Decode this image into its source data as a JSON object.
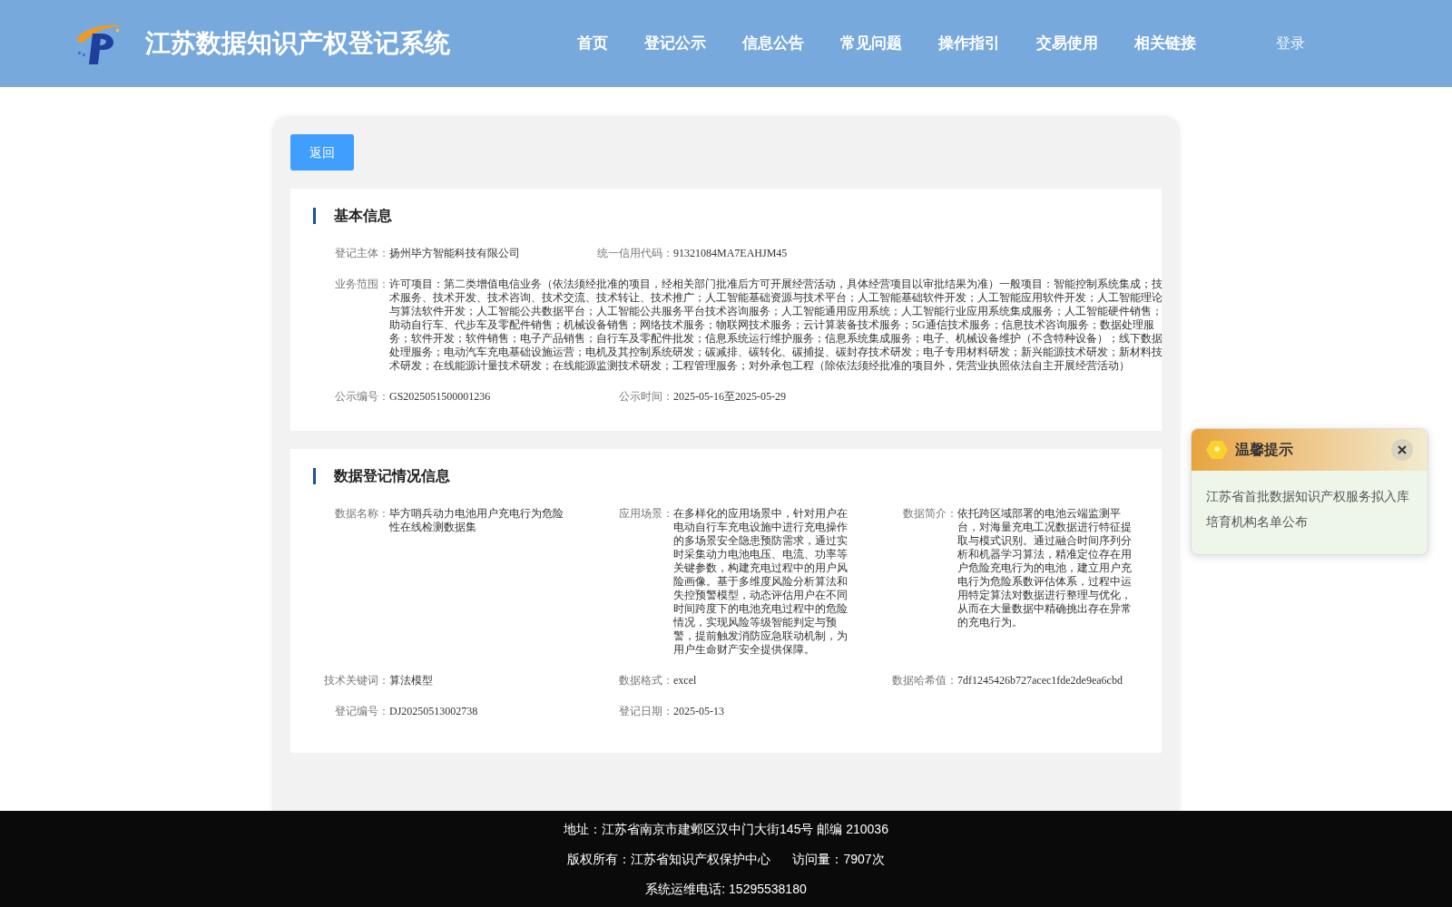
{
  "header": {
    "title": "江苏数据知识产权登记系统",
    "nav": [
      {
        "label": "首页",
        "selected": false
      },
      {
        "label": "登记公示",
        "selected": false
      },
      {
        "label": "信息公告",
        "selected": false
      },
      {
        "label": "常见问题",
        "selected": false
      },
      {
        "label": "操作指引",
        "selected": false
      },
      {
        "label": "交易使用",
        "selected": false
      },
      {
        "label": "相关链接",
        "selected": false
      }
    ],
    "login": "登录"
  },
  "back_button": "返回",
  "sections": [
    {
      "title": "基本信息",
      "rows": [
        [
          {
            "label": "登记主体：",
            "value": "扬州毕方智能科技有限公司"
          },
          {
            "label": "统一信用代码：",
            "value": "91321084MA7EAHJM45"
          }
        ],
        [
          {
            "label": "业务范围：",
            "value": "许可项目：第二类增值电信业务（依法须经批准的项目，经相关部门批准后方可开展经营活动，具体经营项目以审批结果为准）一般项目：智能控制系统集成；技术服务、技术开发、技术咨询、技术交流、技术转让、技术推广；人工智能基础资源与技术平台；人工智能基础软件开发；人工智能应用软件开发；人工智能理论与算法软件开发；人工智能公共数据平台；人工智能公共服务平台技术咨询服务；人工智能通用应用系统；人工智能行业应用系统集成服务；人工智能硬件销售；助动自行车、代步车及零配件销售；机械设备销售；网络技术服务；物联网技术服务；云计算装备技术服务；5G通信技术服务；信息技术咨询服务；数据处理服务；软件开发；软件销售；电子产品销售；自行车及零配件批发；信息系统运行维护服务；信息系统集成服务；电子、机械设备维护（不含特种设备）；线下数据处理服务；电动汽车充电基础设施运营；电机及其控制系统研发；碳减排、碳转化、碳捕捉、碳封存技术研发；电子专用材料研发；新兴能源技术研发；新材料技术研发；在线能源计量技术研发；在线能源监测技术研发；工程管理服务；对外承包工程（除依法须经批准的项目外，凭营业执照依法自主开展经营活动）",
            "wide": true
          }
        ],
        [
          {
            "label": "公示编号：",
            "value": "GS2025051500001236"
          },
          {
            "label": "公示时间：",
            "value": "2025-05-16至2025-05-29"
          }
        ]
      ]
    },
    {
      "title": "数据登记情况信息",
      "rows": [
        [
          {
            "label": "数据名称：",
            "value": "毕方哨兵动力电池用户充电行为危险性在线检测数据集"
          },
          {
            "label": "应用场景：",
            "value": "在多样化的应用场景中，针对用户在电动自行车充电设施中进行充电操作的多场景安全隐患预防需求，通过实时采集动力电池电压、电流、功率等关键参数，构建充电过程中的用户风险画像。基于多维度风险分析算法和失控预警模型，动态评估用户在不同时间跨度下的电池充电过程中的危险情况，实现风险等级智能判定与预警，提前触发消防应急联动机制，为用户生命财产安全提供保障。"
          },
          {
            "label": "数据简介：",
            "value": "依托跨区域部署的电池云端监测平台，对海量充电工况数据进行特征提取与模式识别。通过融合时间序列分析和机器学习算法，精准定位存在用户危险充电行为的电池，建立用户充电行为危险系数评估体系，过程中运用特定算法对数据进行整理与优化，从而在大量数据中精确挑出存在异常的充电行为。"
          }
        ],
        [
          {
            "label": "技术关键词：",
            "value": "算法模型"
          },
          {
            "label": "数据格式：",
            "value": "excel"
          },
          {
            "label": "数据哈希值：",
            "value": "7df1245426b727acec1fde2de9ea6cbd"
          }
        ],
        [
          {
            "label": "登记编号：",
            "value": "DJ20250513002738"
          },
          {
            "label": "登记日期：",
            "value": "2025-05-13"
          }
        ]
      ]
    }
  ],
  "notice": {
    "title": "温馨提示",
    "text": "江苏省首批数据知识产权服务拟入库培育机构名单公布"
  },
  "footer": {
    "lines": [
      "地址：江苏省南京市建邺区汉中门大街145号 邮编 210036",
      "系统运维电话: 15295538180"
    ],
    "copyright": "版权所有：江苏省知识产权保护中心",
    "visits": "访问量：7907次"
  }
}
